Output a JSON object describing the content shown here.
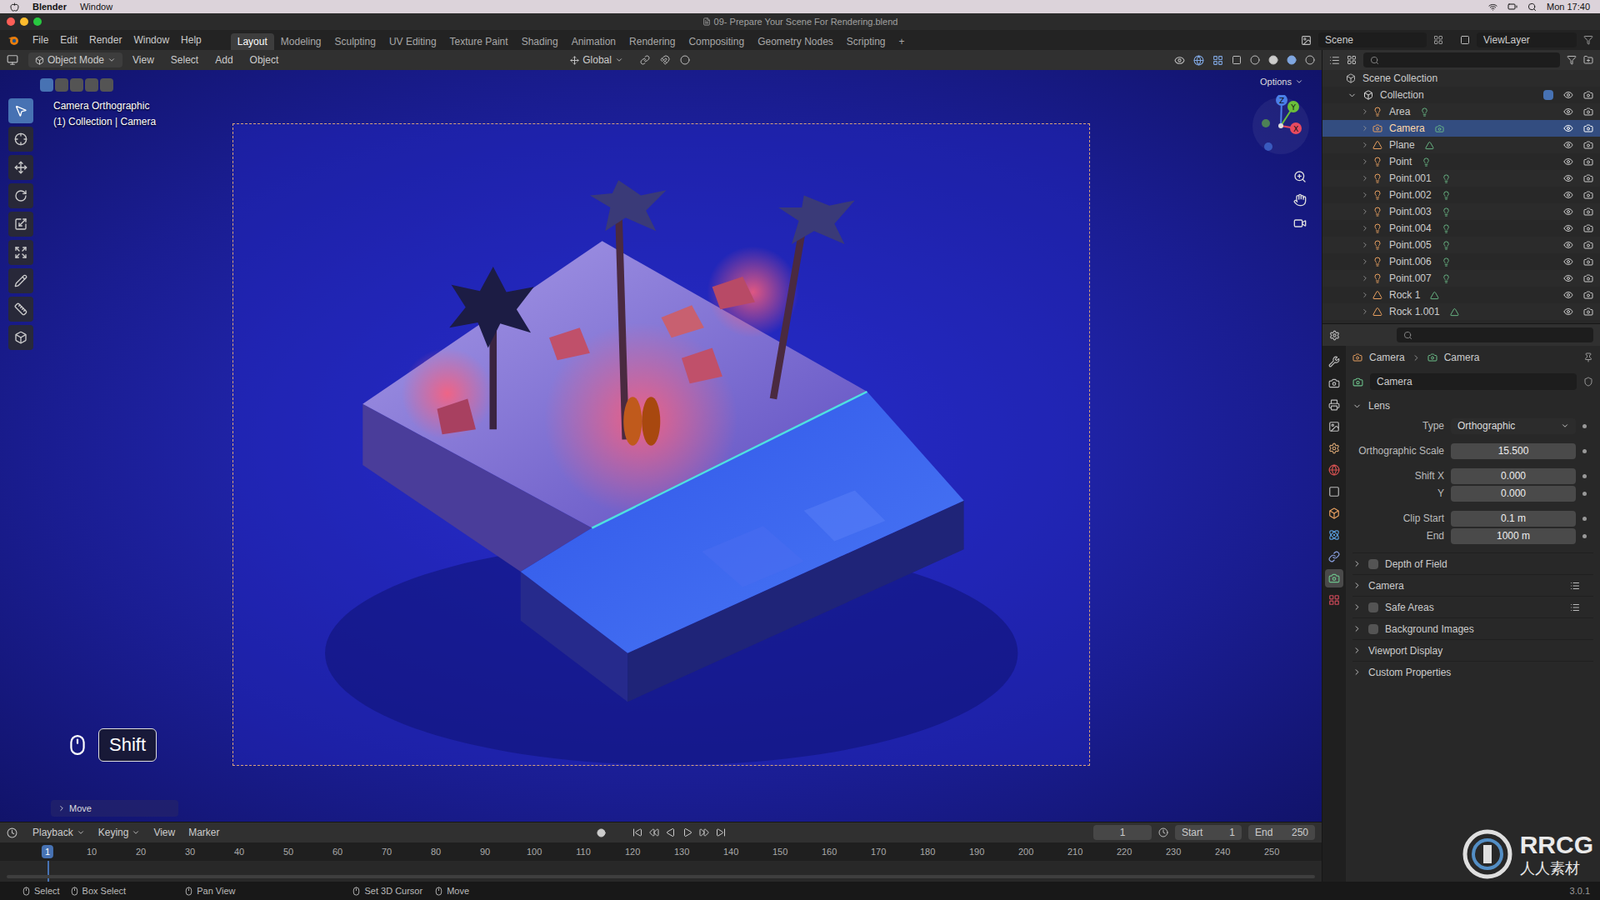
{
  "mac_menubar": {
    "app": "Blender",
    "menus": [
      "Window"
    ],
    "clock": "Mon 17:40"
  },
  "window": {
    "title": "09- Prepare Your Scene For Rendering.blend"
  },
  "topbar": {
    "menus": [
      "File",
      "Edit",
      "Render",
      "Window",
      "Help"
    ],
    "workspaces": [
      {
        "label": "Layout",
        "selected": true
      },
      {
        "label": "Modeling",
        "selected": false
      },
      {
        "label": "Sculpting",
        "selected": false
      },
      {
        "label": "UV Editing",
        "selected": false
      },
      {
        "label": "Texture Paint",
        "selected": false
      },
      {
        "label": "Shading",
        "selected": false
      },
      {
        "label": "Animation",
        "selected": false
      },
      {
        "label": "Rendering",
        "selected": false
      },
      {
        "label": "Compositing",
        "selected": false
      },
      {
        "label": "Geometry Nodes",
        "selected": false
      },
      {
        "label": "Scripting",
        "selected": false
      }
    ],
    "add_workspace": "+",
    "scene": "Scene",
    "view_layer": "ViewLayer"
  },
  "viewport_header": {
    "mode": "Object Mode",
    "menus": [
      "View",
      "Select",
      "Add",
      "Object"
    ],
    "orientation": "Global"
  },
  "viewport": {
    "select_modes": [
      {
        "selected": true
      },
      {
        "selected": false
      },
      {
        "selected": false
      },
      {
        "selected": false
      },
      {
        "selected": false
      }
    ],
    "camera_label": "Camera Orthographic",
    "collection_label": "(1) Collection | Camera",
    "options": "Options",
    "gizmo_axes": [
      "X",
      "Y",
      "Z"
    ],
    "toolbar": [
      {
        "selected": true
      },
      {
        "selected": false
      },
      {
        "selected": false
      },
      {
        "selected": false
      },
      {
        "selected": false
      },
      {
        "selected": false
      },
      {
        "selected": false
      },
      {
        "selected": false
      },
      {
        "selected": false
      }
    ],
    "key_hint": "Shift",
    "operator_panel": "Move"
  },
  "outliner": {
    "root": "Scene Collection",
    "collection": "Collection",
    "items": [
      {
        "name": "Area",
        "kind": "light",
        "selected": false
      },
      {
        "name": "Camera",
        "kind": "camera",
        "selected": true
      },
      {
        "name": "Plane",
        "kind": "mesh",
        "selected": false
      },
      {
        "name": "Point",
        "kind": "light",
        "selected": false
      },
      {
        "name": "Point.001",
        "kind": "light",
        "selected": false
      },
      {
        "name": "Point.002",
        "kind": "light",
        "selected": false
      },
      {
        "name": "Point.003",
        "kind": "light",
        "selected": false
      },
      {
        "name": "Point.004",
        "kind": "light",
        "selected": false
      },
      {
        "name": "Point.005",
        "kind": "light",
        "selected": false
      },
      {
        "name": "Point.006",
        "kind": "light",
        "selected": false
      },
      {
        "name": "Point.007",
        "kind": "light",
        "selected": false
      },
      {
        "name": "Rock 1",
        "kind": "mesh",
        "selected": false
      },
      {
        "name": "Rock 1.001",
        "kind": "mesh",
        "selected": false
      }
    ]
  },
  "properties": {
    "tabs": [
      {
        "selected": false
      },
      {
        "selected": false
      },
      {
        "selected": false
      },
      {
        "selected": false
      },
      {
        "selected": false
      },
      {
        "selected": false
      },
      {
        "selected": false
      },
      {
        "selected": false
      },
      {
        "selected": false
      },
      {
        "selected": false
      },
      {
        "selected": true
      },
      {
        "selected": false
      }
    ],
    "breadcrumb": [
      "Camera",
      "Camera"
    ],
    "datablock": "Camera",
    "panel": "Lens",
    "field_groups": [
      [
        {
          "label": "Type",
          "value": "Orthographic",
          "kind": "dropdown"
        }
      ],
      [
        {
          "label": "Orthographic Scale",
          "value": "15.500",
          "kind": "number"
        }
      ],
      [
        {
          "label": "Shift X",
          "value": "0.000",
          "kind": "number"
        },
        {
          "label": "Y",
          "value": "0.000",
          "kind": "number"
        }
      ],
      [
        {
          "label": "Clip Start",
          "value": "0.1 m",
          "kind": "number"
        },
        {
          "label": "End",
          "value": "1000 m",
          "kind": "number"
        }
      ]
    ],
    "sections": [
      {
        "label": "Depth of Field",
        "kind": "toggle",
        "checked": false
      },
      {
        "label": "Camera",
        "kind": "presets"
      },
      {
        "label": "Safe Areas",
        "kind": "toggle_presets",
        "checked": false
      },
      {
        "label": "Background Images",
        "kind": "toggle",
        "checked": false
      },
      {
        "label": "Viewport Display",
        "kind": "plain"
      },
      {
        "label": "Custom Properties",
        "kind": "plain"
      }
    ]
  },
  "timeline": {
    "menus": [
      {
        "label": "Playback",
        "kind": "dropdown"
      },
      {
        "label": "Keying",
        "kind": "dropdown"
      },
      {
        "label": "View",
        "kind": "menu"
      },
      {
        "label": "Marker",
        "kind": "menu"
      }
    ],
    "current_frame": "1",
    "start_label": "Start",
    "start": "1",
    "end_label": "End",
    "end": "250",
    "ticks": [
      "1",
      "10",
      "20",
      "30",
      "40",
      "50",
      "60",
      "70",
      "80",
      "90",
      "100",
      "110",
      "120",
      "130",
      "140",
      "150",
      "160",
      "170",
      "180",
      "190",
      "200",
      "210",
      "220",
      "230",
      "240",
      "250"
    ]
  },
  "status_bar": {
    "items": [
      "Select",
      "Box Select",
      "Pan View",
      "Set 3D Cursor",
      "Move"
    ],
    "version": "3.0.1"
  },
  "watermark": {
    "logo": "RRCG",
    "subtitle": "人人素材"
  }
}
